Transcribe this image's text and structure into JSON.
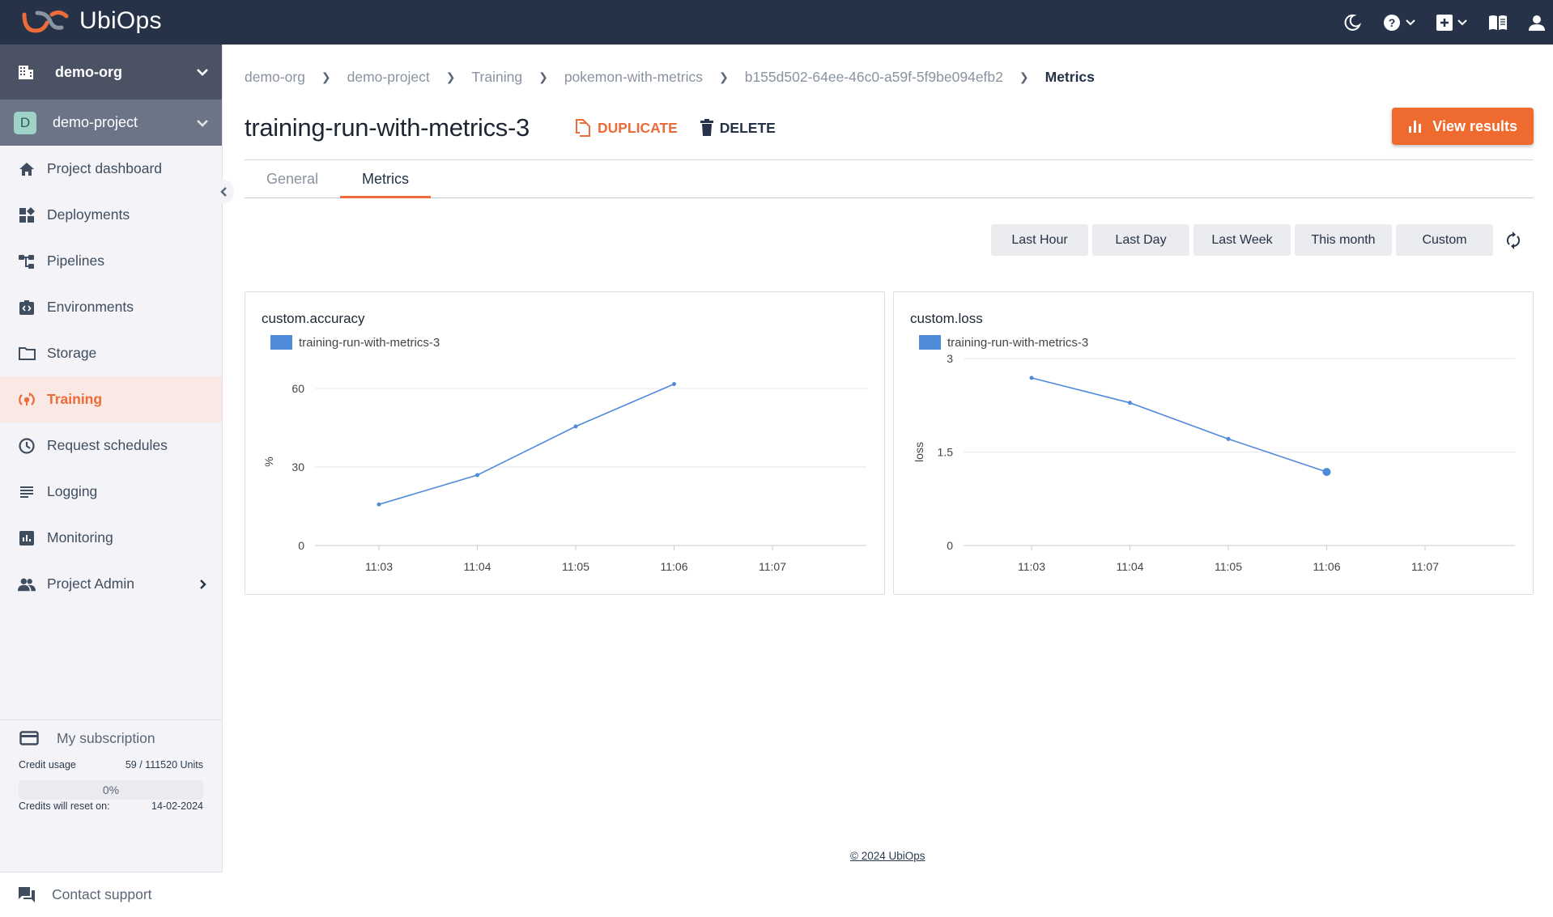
{
  "app": {
    "name": "UbiOps",
    "brand_color": "#ec6b3a",
    "header_bg": "#253247"
  },
  "topbar": {
    "icons": [
      "moon-icon",
      "help-icon",
      "add-icon",
      "docs-icon",
      "user-icon"
    ]
  },
  "sidebar": {
    "org": "demo-org",
    "project": "demo-project",
    "project_initial": "D",
    "items": [
      {
        "label": "Project dashboard",
        "icon": "home-icon"
      },
      {
        "label": "Deployments",
        "icon": "deployments-icon"
      },
      {
        "label": "Pipelines",
        "icon": "pipelines-icon"
      },
      {
        "label": "Environments",
        "icon": "environments-icon"
      },
      {
        "label": "Storage",
        "icon": "folder-icon"
      },
      {
        "label": "Training",
        "icon": "training-icon",
        "active": true
      },
      {
        "label": "Request schedules",
        "icon": "clock-icon"
      },
      {
        "label": "Logging",
        "icon": "logging-icon"
      },
      {
        "label": "Monitoring",
        "icon": "monitoring-icon"
      },
      {
        "label": "Project Admin",
        "icon": "users-icon",
        "has_submenu": true
      }
    ],
    "subscription": {
      "label": "My subscription",
      "credit_usage_label": "Credit usage",
      "credit_usage_value": "59 / 111520 Units",
      "progress_percent": 0,
      "progress_label": "0%",
      "reset_label": "Credits will reset on:",
      "reset_date": "14-02-2024"
    },
    "support_label": "Contact support"
  },
  "breadcrumb": [
    {
      "label": "demo-org"
    },
    {
      "label": "demo-project"
    },
    {
      "label": "Training"
    },
    {
      "label": "pokemon-with-metrics"
    },
    {
      "label": "b155d502-64ee-46c0-a59f-5f9be094efb2"
    },
    {
      "label": "Metrics",
      "current": true
    }
  ],
  "page": {
    "title": "training-run-with-metrics-3",
    "duplicate_label": "DUPLICATE",
    "delete_label": "DELETE",
    "view_results_label": "View results"
  },
  "tabs": [
    {
      "label": "General",
      "active": false
    },
    {
      "label": "Metrics",
      "active": true
    }
  ],
  "time_ranges": [
    "Last Hour",
    "Last Day",
    "Last Week",
    "This month",
    "Custom"
  ],
  "footer": "© 2024 UbiOps",
  "chart_data": [
    {
      "type": "line",
      "title": "custom.accuracy",
      "xlabel": "",
      "ylabel": "%",
      "x_ticks": [
        "11:03",
        "11:04",
        "11:05",
        "11:06",
        "11:07"
      ],
      "y_ticks": [
        0,
        30,
        60
      ],
      "ylim": [
        0,
        64
      ],
      "grid": true,
      "legend_placement": "top-left",
      "series": [
        {
          "name": "training-run-with-metrics-3",
          "color": "#4f8ad9",
          "x": [
            "11:03",
            "11:04",
            "11:05",
            "11:06"
          ],
          "values": [
            15.7,
            26.9,
            45.5,
            61.7
          ]
        }
      ]
    },
    {
      "type": "line",
      "title": "custom.loss",
      "xlabel": "",
      "ylabel": "loss",
      "x_ticks": [
        "11:03",
        "11:04",
        "11:05",
        "11:06",
        "11:07"
      ],
      "y_ticks": [
        0,
        1.5,
        3
      ],
      "ylim": [
        0,
        3
      ],
      "grid": true,
      "legend_placement": "top-left",
      "series": [
        {
          "name": "training-run-with-metrics-3",
          "color": "#4f8ad9",
          "x": [
            "11:03",
            "11:04",
            "11:05",
            "11:06"
          ],
          "values": [
            2.69,
            2.29,
            1.71,
            1.18
          ]
        }
      ]
    }
  ]
}
